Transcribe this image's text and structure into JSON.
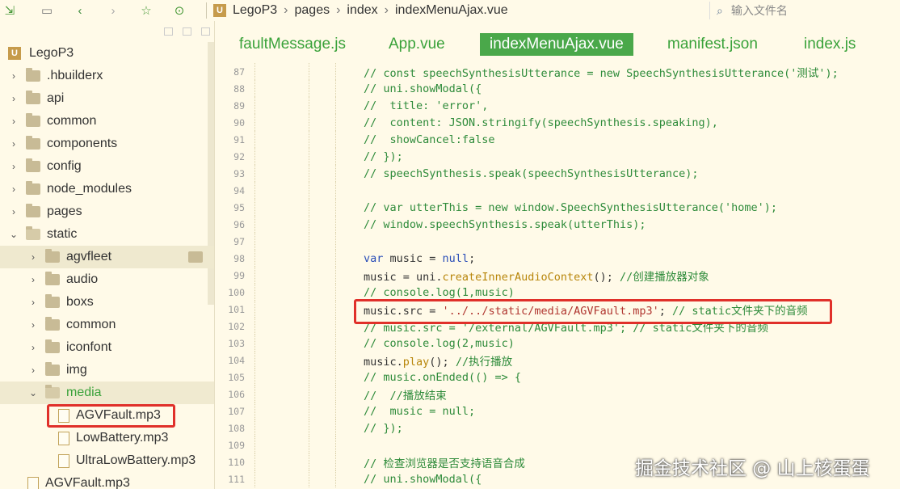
{
  "toolbar": {
    "breadcrumb": [
      "LegoP3",
      "pages",
      "index",
      "indexMenuAjax.vue"
    ],
    "search_placeholder": "输入文件名"
  },
  "sidebar": {
    "project": "LegoP3",
    "items": [
      {
        "label": ".hbuilderx",
        "type": "folder",
        "depth": 1,
        "expanded": false
      },
      {
        "label": "api",
        "type": "folder",
        "depth": 1,
        "expanded": false
      },
      {
        "label": "common",
        "type": "folder",
        "depth": 1,
        "expanded": false
      },
      {
        "label": "components",
        "type": "folder",
        "depth": 1,
        "expanded": false
      },
      {
        "label": "config",
        "type": "folder",
        "depth": 1,
        "expanded": false
      },
      {
        "label": "node_modules",
        "type": "folder",
        "depth": 1,
        "expanded": false
      },
      {
        "label": "pages",
        "type": "folder",
        "depth": 1,
        "expanded": false
      },
      {
        "label": "static",
        "type": "folder",
        "depth": 1,
        "expanded": true
      },
      {
        "label": "agvfleet",
        "type": "folder",
        "depth": 2,
        "expanded": false
      },
      {
        "label": "audio",
        "type": "folder",
        "depth": 2,
        "expanded": false
      },
      {
        "label": "boxs",
        "type": "folder",
        "depth": 2,
        "expanded": false
      },
      {
        "label": "common",
        "type": "folder",
        "depth": 2,
        "expanded": false
      },
      {
        "label": "iconfont",
        "type": "folder",
        "depth": 2,
        "expanded": false
      },
      {
        "label": "img",
        "type": "folder",
        "depth": 2,
        "expanded": false
      },
      {
        "label": "media",
        "type": "folder",
        "depth": 2,
        "expanded": true
      },
      {
        "label": "AGVFault.mp3",
        "type": "file",
        "depth": 3
      },
      {
        "label": "LowBattery.mp3",
        "type": "file",
        "depth": 3
      },
      {
        "label": "UltraLowBattery.mp3",
        "type": "file",
        "depth": 3
      },
      {
        "label": "AGVFault.mp3",
        "type": "file",
        "depth": 2
      }
    ]
  },
  "tabs": [
    {
      "label": "faultMessage.js",
      "active": false
    },
    {
      "label": "App.vue",
      "active": false
    },
    {
      "label": "indexMenuAjax.vue",
      "active": true
    },
    {
      "label": "manifest.json",
      "active": false
    },
    {
      "label": "index.js",
      "active": false
    }
  ],
  "code_lines": [
    {
      "n": "87",
      "text": "// const speechSynthesisUtterance = new SpeechSynthesisUtterance('测试');"
    },
    {
      "n": "88",
      "text": "// uni.showModal({"
    },
    {
      "n": "89",
      "text": "//  title: 'error',"
    },
    {
      "n": "90",
      "text": "//  content: JSON.stringify(speechSynthesis.speaking),"
    },
    {
      "n": "91",
      "text": "//  showCancel:false"
    },
    {
      "n": "92",
      "text": "// });"
    },
    {
      "n": "93",
      "text": "// speechSynthesis.speak(speechSynthesisUtterance);"
    },
    {
      "n": "94",
      "text": ""
    },
    {
      "n": "95",
      "text": "// var utterThis = new window.SpeechSynthesisUtterance('home');"
    },
    {
      "n": "96",
      "text": "// window.speechSynthesis.speak(utterThis);"
    },
    {
      "n": "97",
      "text": ""
    },
    {
      "n": "98",
      "text": "var music = null;"
    },
    {
      "n": "99",
      "text": "music = uni.createInnerAudioContext(); //创建播放器对象"
    },
    {
      "n": "100",
      "text": "// console.log(1,music)"
    },
    {
      "n": "101",
      "text": "music.src = '../../static/media/AGVFault.mp3'; // static文件夹下的音频"
    },
    {
      "n": "102",
      "text": "// music.src = '/external/AGVFault.mp3'; // static文件夹下的音频"
    },
    {
      "n": "103",
      "text": "// console.log(2,music)"
    },
    {
      "n": "104",
      "text": "music.play(); //执行播放"
    },
    {
      "n": "105",
      "text": "// music.onEnded(() => {"
    },
    {
      "n": "106",
      "text": "//  //播放结束"
    },
    {
      "n": "107",
      "text": "//  music = null;"
    },
    {
      "n": "108",
      "text": "// });"
    },
    {
      "n": "109",
      "text": ""
    },
    {
      "n": "110",
      "text": "// 检查浏览器是否支持语音合成"
    },
    {
      "n": "111",
      "text": "// uni.showModal({"
    }
  ],
  "watermark": "掘金技术社区 @ 山上核蛋蛋"
}
